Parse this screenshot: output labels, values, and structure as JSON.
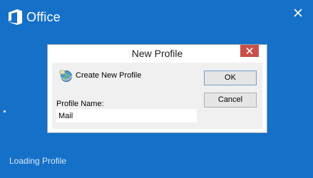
{
  "splash": {
    "app_name": "Office",
    "status_text": "Loading Profile",
    "logo_icon": "office-logo-icon",
    "close_icon": "close-icon",
    "background": "#1570c8",
    "logo_color": "#ffffff"
  },
  "dialog": {
    "title": "New Profile",
    "heading": "Create New Profile",
    "heading_icon": "profile-globe-icon",
    "field_label": "Profile Name:",
    "field_value": "Mail",
    "ok_label": "OK",
    "cancel_label": "Cancel",
    "close_icon": "close-icon",
    "close_button_color": "#c7504b"
  }
}
